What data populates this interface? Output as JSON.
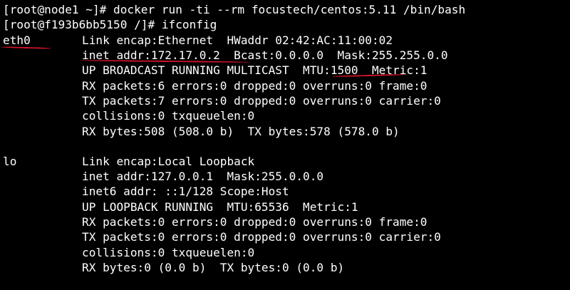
{
  "terminal": {
    "lines": [
      "[root@node1 ~]# docker run -ti --rm focustech/centos:5.11 /bin/bash",
      "[root@f193b6bb5150 /]# ifconfig",
      "eth0",
      "Link encap:Ethernet  HWaddr 02:42:AC:11:00:02",
      "inet addr:172.17.0.2  Bcast:0.0.0.0  Mask:255.255.0.0",
      "UP BROADCAST RUNNING MULTICAST  MTU:1500  Metric:1",
      "RX packets:6 errors:0 dropped:0 overruns:0 frame:0",
      "TX packets:7 errors:0 dropped:0 overruns:0 carrier:0",
      "collisions:0 txqueuelen:0",
      "RX bytes:508 (508.0 b)  TX bytes:578 (578.0 b)",
      "lo",
      "Link encap:Local Loopback",
      "inet addr:127.0.0.1  Mask:255.0.0.0",
      "inet6 addr: ::1/128 Scope:Host",
      "UP LOOPBACK RUNNING  MTU:65536  Metric:1",
      "RX packets:0 errors:0 dropped:0 overruns:0 frame:0",
      "TX packets:0 errors:0 dropped:0 overruns:0 carrier:0",
      "collisions:0 txqueuelen:0",
      "RX bytes:0 (0.0 b)  TX bytes:0 (0.0 b)"
    ],
    "colors": {
      "background": "#000000",
      "text": "#ffffff",
      "annotation": "#d9142b"
    }
  }
}
